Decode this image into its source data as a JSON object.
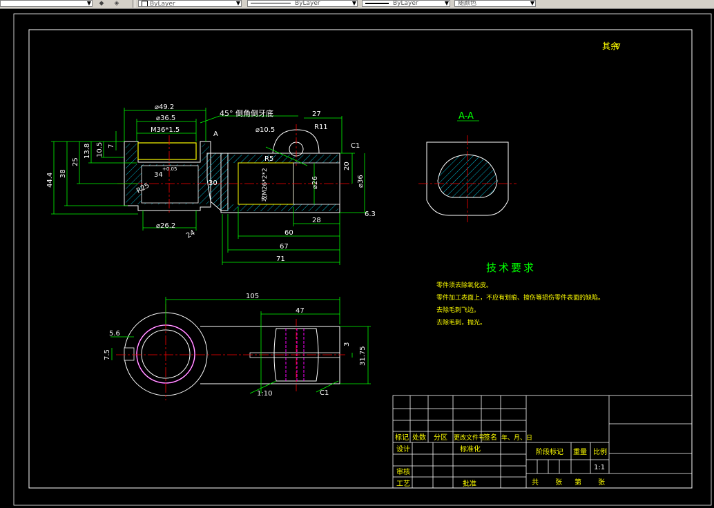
{
  "toolbar": {
    "layer_combo_1": "ByLayer",
    "layer_combo_2": "ByLayer",
    "layer_combo_3": "ByLayer",
    "color_combo": "随颜色"
  },
  "colors": {
    "drawing_frame": "#ffffff",
    "dimension": "#00ff00",
    "center_line": "#ff0000",
    "hatch": "#00bcd4",
    "visible_edge": "#ffffff",
    "highlight": "#ffff00",
    "hidden": "#ff00ff"
  },
  "drawing": {
    "corner_note": "其余",
    "roughness_mark": "∇",
    "section_title": "A-A",
    "tech_title": "技术要求",
    "tech_items": [
      "零件须去除氧化皮。",
      "零件加工表面上，不应有划痕、擦伤等损伤零件表面的缺陷。",
      "去除毛刺飞边。",
      "去除毛刺，抛光。"
    ],
    "dimensions": {
      "d49_2": "⌀49.2",
      "d36_5": "⌀36.5",
      "m36": "M36*1.5",
      "chamfer_note": "45° 倒角倒牙底",
      "sec_mark": "A",
      "dim27": "27",
      "r11": "R11",
      "d10_5": "⌀10.5",
      "c1_top": "C1",
      "r5": "R5",
      "dim20": "20",
      "d36": "⌀36",
      "d26": "⌀26",
      "thread_note": "攻M26*2*2",
      "dim44_4": "44.4",
      "dim38": "38",
      "dim25": "25",
      "dim13_8": "13.8",
      "dim10_5": "10.5",
      "dim7": "7",
      "dim34": "34",
      "tol": "+0.05",
      "r25": "R25",
      "dim30": "30",
      "d26_2": "⌀26.2",
      "dim24": "24",
      "dim28": "28",
      "dim60": "60",
      "dim67": "67",
      "dim71": "71",
      "dim6_3": "6.3",
      "dim105": "105",
      "dim47": "47",
      "dim5_6": "5.6",
      "dim7_5": "7.5",
      "dim3": "3",
      "dim31_75": "31.75",
      "taper": "1:10",
      "c1_bottom": "C1"
    },
    "title_block": {
      "h_mark": "标记",
      "h_count": "处数",
      "h_zone": "分区",
      "h_doc": "更改文件号",
      "h_sign": "签名",
      "h_date": "年、月、日",
      "design": "设计",
      "standard": "标准化",
      "review": "审核",
      "process": "工艺",
      "approve": "批准",
      "stage": "阶段标记",
      "weight": "重量",
      "scale": "比例",
      "scale_val": "1:1",
      "total": "共",
      "sheets1": "张",
      "sheet_no": "第",
      "sheets2": "张"
    }
  }
}
